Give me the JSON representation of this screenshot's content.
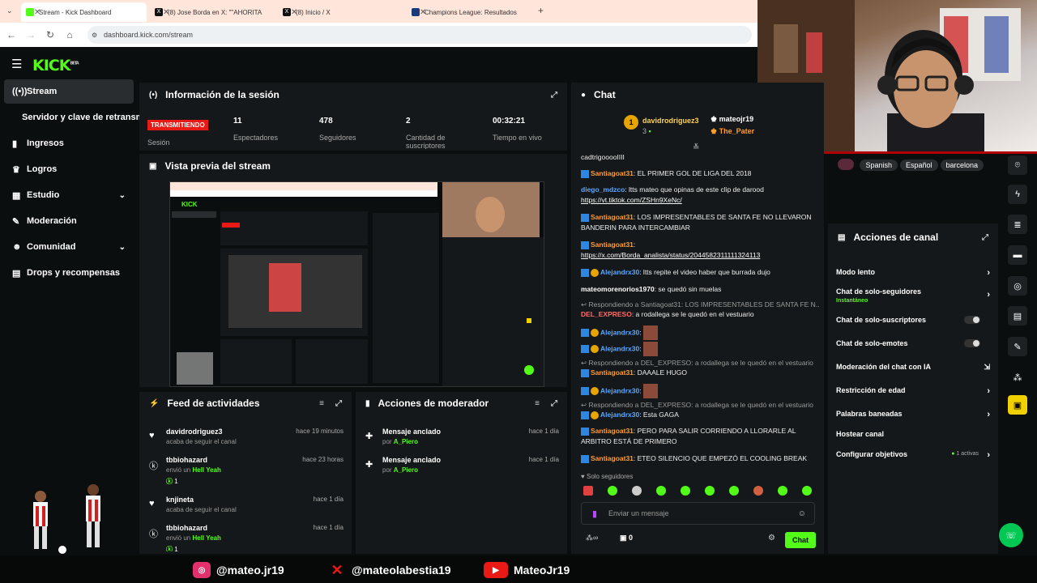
{
  "browser": {
    "tabs": [
      {
        "title": "Stream - Kick Dashboard",
        "active": true
      },
      {
        "title": "(8) Jose Borda en X: \"\"AHORITA",
        "active": false
      },
      {
        "title": "(8) Inicio / X",
        "active": false
      },
      {
        "title": "Champions League: Resultados",
        "active": false
      }
    ],
    "url": "dashboard.kick.com/stream"
  },
  "app": {
    "logo": "KICK",
    "logo_sup": "BETA"
  },
  "sidebar": {
    "items": [
      {
        "label": "Stream",
        "icon": "radio-icon",
        "active": true
      },
      {
        "label": "Servidor y clave de retransmisión",
        "icon": "",
        "active": false
      },
      {
        "label": "Ingresos",
        "icon": "chart-icon"
      },
      {
        "label": "Logros",
        "icon": "trophy-icon"
      },
      {
        "label": "Estudio",
        "icon": "grid-icon",
        "expandable": true
      },
      {
        "label": "Moderación",
        "icon": "wrench-icon"
      },
      {
        "label": "Comunidad",
        "icon": "users-icon",
        "expandable": true
      },
      {
        "label": "Drops y recompensas",
        "icon": "gift-icon"
      }
    ]
  },
  "session": {
    "title": "Información de la sesión",
    "status": "TRANSMITIENDO",
    "status_label": "Sesión",
    "stats": [
      {
        "value": "11",
        "label": "Espectadores"
      },
      {
        "value": "478",
        "label": "Seguidores"
      },
      {
        "value": "2",
        "label": "Cantidad de suscriptores"
      },
      {
        "value": "00:32:21",
        "label": "Tiempo en vivo"
      }
    ]
  },
  "preview": {
    "title": "Vista previa del stream"
  },
  "feed": {
    "title": "Feed de actividades",
    "items": [
      {
        "user": "davidrodriguez3",
        "desc": "acaba de seguir el canal",
        "time": "hace 19 minutos",
        "icon": "heart-icon"
      },
      {
        "user": "tbbiohazard",
        "desc": "envió un",
        "gift": "Hell Yeah",
        "count": "1",
        "time": "hace 23 horas",
        "icon": "kick-icon"
      },
      {
        "user": "knjineta",
        "desc": "acaba de seguir el canal",
        "time": "hace 1 día",
        "icon": "heart-icon"
      },
      {
        "user": "tbbiohazard",
        "desc": "envió un",
        "gift": "Hell Yeah",
        "count": "1",
        "time": "hace 1 día",
        "icon": "kick-icon"
      }
    ]
  },
  "modactions": {
    "title": "Acciones de moderador",
    "items": [
      {
        "title": "Mensaje anclado",
        "by": "por",
        "user": "A_Piero",
        "time": "hace 1 día"
      },
      {
        "title": "Mensaje anclado",
        "by": "por",
        "user": "A_Piero",
        "time": "hace 1 día"
      }
    ]
  },
  "chat": {
    "title": "Chat",
    "pinned_user": "davidrodriguez3",
    "pinned_count": "3",
    "pinned_user2": "mateojr19",
    "pinned_user3": "The_Pater",
    "messages": [
      {
        "user": "",
        "text": "cadtrigooooIIII"
      },
      {
        "user": "Santiagoat31",
        "text": ": EL PRIMER GOL DE LIGA DEL 2018"
      },
      {
        "user": "diego_mdzco",
        "text": ": ltts mateo que opinas de este clip de darood",
        "link": "https://vt.tiktok.com/ZSHn9XeNc/"
      },
      {
        "user": "Santiagoat31",
        "text": ": LOS IMPRESENTABLES DE SANTA FE NO LLEVARON BANDERIN PARA INTERCAMBIAR"
      },
      {
        "user": "Santiagoat31",
        "text": ":",
        "link": "https://x.com/Borda_analista/status/2044582311111324113"
      },
      {
        "user": "Alejandrx30",
        "text": ": ltts repite el video haber que burrada dujo"
      },
      {
        "user": "mateomorenorios1970",
        "text": ": se quedó sin muelas"
      },
      {
        "reply": "Respondiendo a Santiagoat31: LOS IMPRESENTABLES DE SANTA FE N..."
      },
      {
        "user": "DEL_EXPRESO",
        "text": ": a rodallega se le quedó en el vestuario"
      },
      {
        "user": "Alejandrx30",
        "text": ":"
      },
      {
        "user": "Alejandrx30",
        "text": ":"
      },
      {
        "reply": "Respondiendo a DEL_EXPRESO: a rodallega se le quedó en el vestuario"
      },
      {
        "user": "Santiagoat31",
        "text": ": DAAALE HUGO"
      },
      {
        "user": "Alejandrx30",
        "text": ":"
      },
      {
        "reply": "Respondiendo a DEL_EXPRESO: a rodallega se le quedó en el vestuario"
      },
      {
        "user": "Alejandrx30",
        "text": ": Esta GAGA"
      },
      {
        "user": "Santiagoat31",
        "text": ": PERO PARA SALIR CORRIENDO A LLORARLE AL ARBITRO ESTÁ DE PRIMERO"
      },
      {
        "user": "Santiagoat31",
        "text": ": ETEO SILENCIO QUE EMPEZÓ EL COOLING BREAK"
      }
    ],
    "mode": "Solo seguidores",
    "placeholder": "Enviar un mensaje",
    "count": "0",
    "send": "Chat"
  },
  "tags": [
    "Spanish",
    "Español",
    "barcelona"
  ],
  "channel_actions": {
    "title": "Acciones de canal",
    "items": [
      {
        "label": "Modo lento",
        "type": "chevron"
      },
      {
        "label": "Chat de solo-seguidores",
        "sub": "Instantáneo",
        "type": "chevron"
      },
      {
        "label": "Chat de solo-suscriptores",
        "type": "toggle"
      },
      {
        "label": "Chat de solo-emotes",
        "type": "toggle"
      },
      {
        "label": "Moderación del chat con IA",
        "type": "external"
      },
      {
        "label": "Restricción de edad",
        "type": "chevron"
      },
      {
        "label": "Palabras baneadas",
        "type": "chevron"
      },
      {
        "label": "Hostear canal",
        "type": "none"
      },
      {
        "label": "Configurar objetivos",
        "extra": "1 activas",
        "type": "chevron"
      }
    ]
  },
  "footer": {
    "instagram": "@mateo.jr19",
    "x": "@mateolabestia19",
    "youtube": "MateoJr19"
  },
  "colors": {
    "accent": "#53fc18",
    "live": "#e91916",
    "panel": "#15181a",
    "bg": "#0b0e0f"
  }
}
